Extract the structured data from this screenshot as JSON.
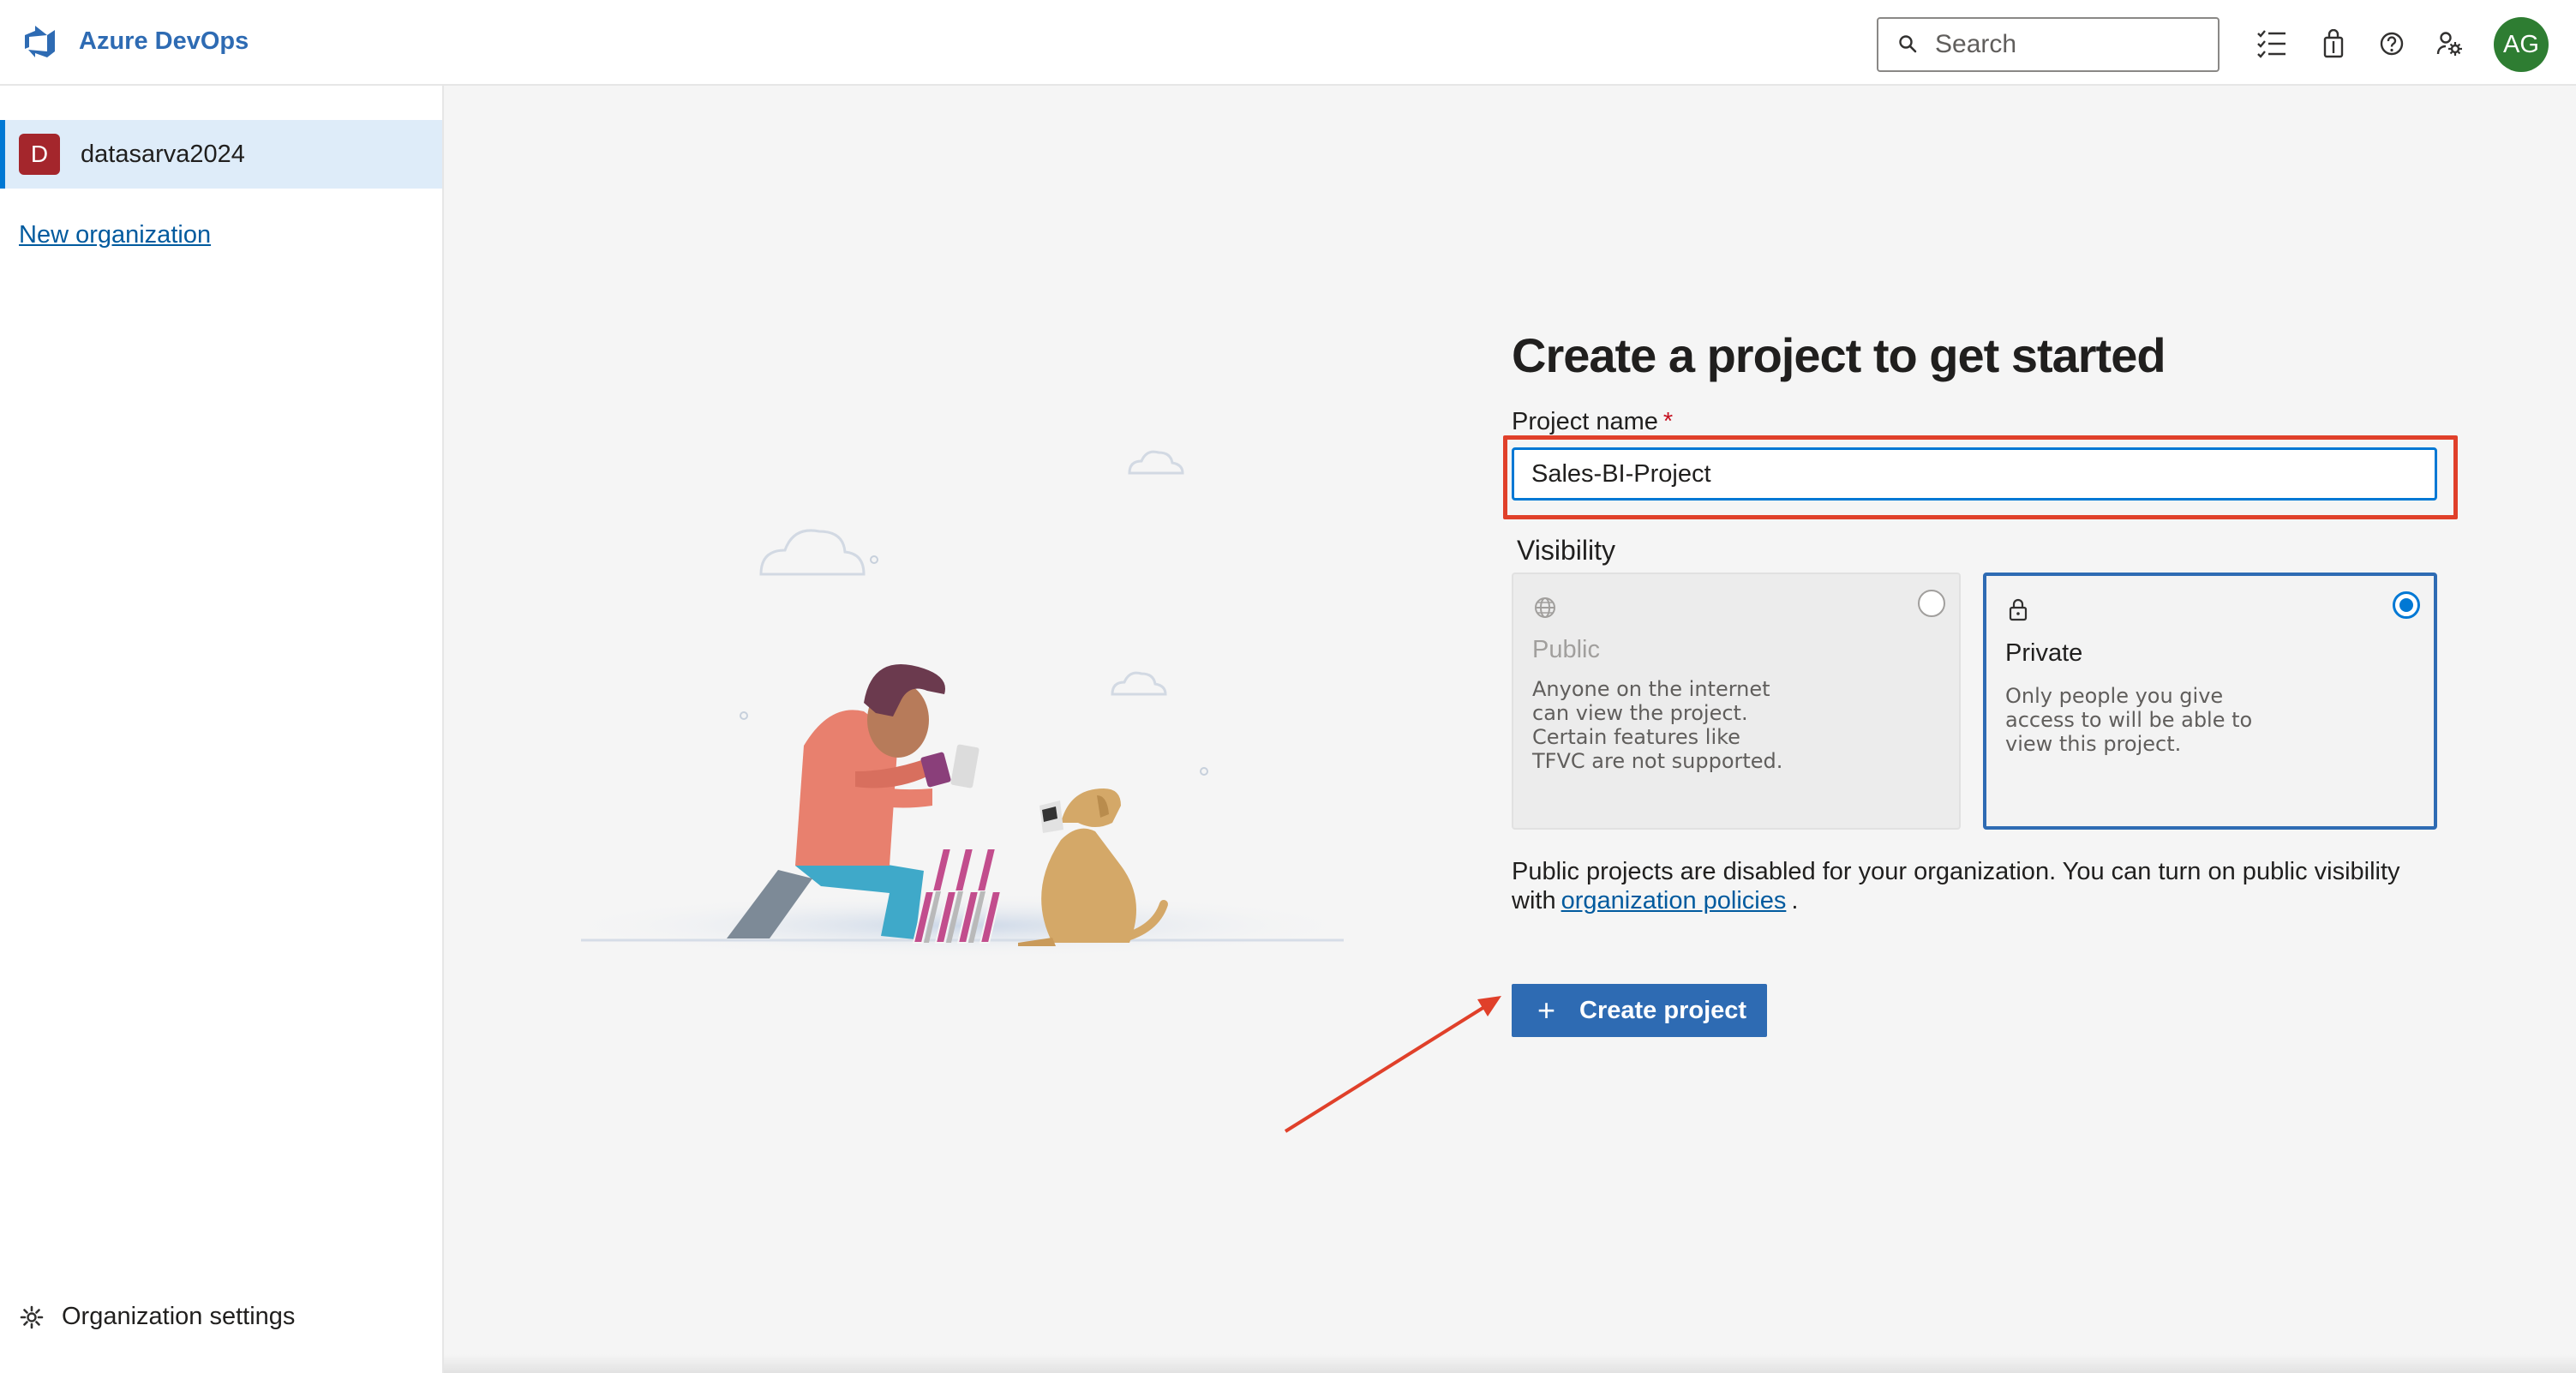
{
  "header": {
    "brand": "Azure DevOps",
    "search_placeholder": "Search",
    "icons": [
      "search-icon",
      "work-items-icon",
      "marketplace-bag-icon",
      "help-icon",
      "user-settings-icon"
    ],
    "avatar_initials": "AG",
    "avatar_color": "#2e7d32"
  },
  "sidebar": {
    "organization": {
      "initial": "D",
      "name": "datasarva2024",
      "color": "#a4262c"
    },
    "new_org_link": "New organization",
    "settings_label": "Organization settings"
  },
  "form": {
    "title": "Create a project to get started",
    "name_label": "Project name",
    "required_marker": "*",
    "name_value": "Sales-BI-Project",
    "visibility_label": "Visibility",
    "visibility_options": [
      {
        "title": "Public",
        "description": "Anyone on the internet can view the project. Certain features like TFVC are not supported.",
        "selected": false,
        "disabled": true,
        "icon": "globe-icon"
      },
      {
        "title": "Private",
        "description": "Only people you give access to will be able to view this project.",
        "selected": true,
        "disabled": false,
        "icon": "lock-icon"
      }
    ],
    "notice_text": "Public projects are disabled for your organization. You can turn on public visibility with",
    "notice_link": "organization policies",
    "notice_end": ".",
    "create_button": "Create project"
  },
  "colors": {
    "accent": "#2e6bb3",
    "highlight": "#e0402a"
  }
}
